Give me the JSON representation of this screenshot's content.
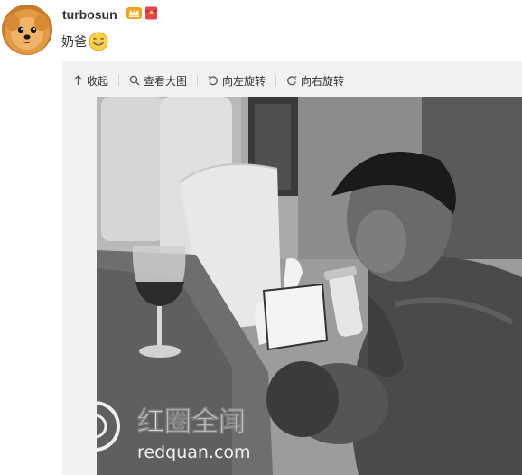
{
  "post": {
    "username": "turbosun",
    "caption": "奶爸",
    "badges": [
      "vip-crown-badge",
      "red-envelope-badge"
    ]
  },
  "toolbar": {
    "collapse_label": "收起",
    "view_large_label": "查看大图",
    "rotate_left_label": "向左旋转",
    "rotate_right_label": "向右旋转"
  },
  "watermark": {
    "brand": "红圈全闻",
    "url": "redquan.com"
  },
  "colors": {
    "media_background": "#f2f2f2",
    "text": "#333333",
    "badge_orange": "#f2a41c",
    "badge_red": "#e8434c"
  }
}
